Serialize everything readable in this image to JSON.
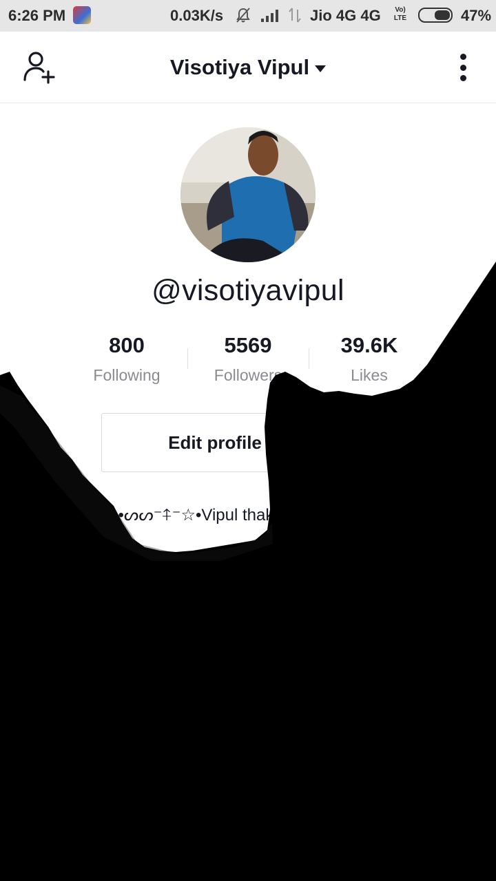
{
  "status_bar": {
    "time": "6:26 PM",
    "speed": "0.03K/s",
    "carrier": "Jio 4G 4G",
    "volte": "Vo) LTE",
    "battery": "47%"
  },
  "header": {
    "profile_name": "Visotiya Vipul",
    "add_friend_icon": "person-add-icon",
    "more_icon": "more-vertical-icon",
    "switcher_icon": "caret-down-icon"
  },
  "profile": {
    "username": "@visotiyavipul",
    "stats": [
      {
        "value": "800",
        "label": "Following"
      },
      {
        "value": "5569",
        "label": "Followers"
      },
      {
        "value": "39.6K",
        "label": "Likes"
      }
    ],
    "edit_profile_label": "Edit profile",
    "bio": "★•ᔕᔕ⁻⍏⁻☆•Vipul thakor"
  },
  "colors": {
    "text_primary": "#161823",
    "text_secondary": "#8a8b91",
    "overlay": "#000000",
    "status_bar_bg": "#e6e6e6"
  }
}
